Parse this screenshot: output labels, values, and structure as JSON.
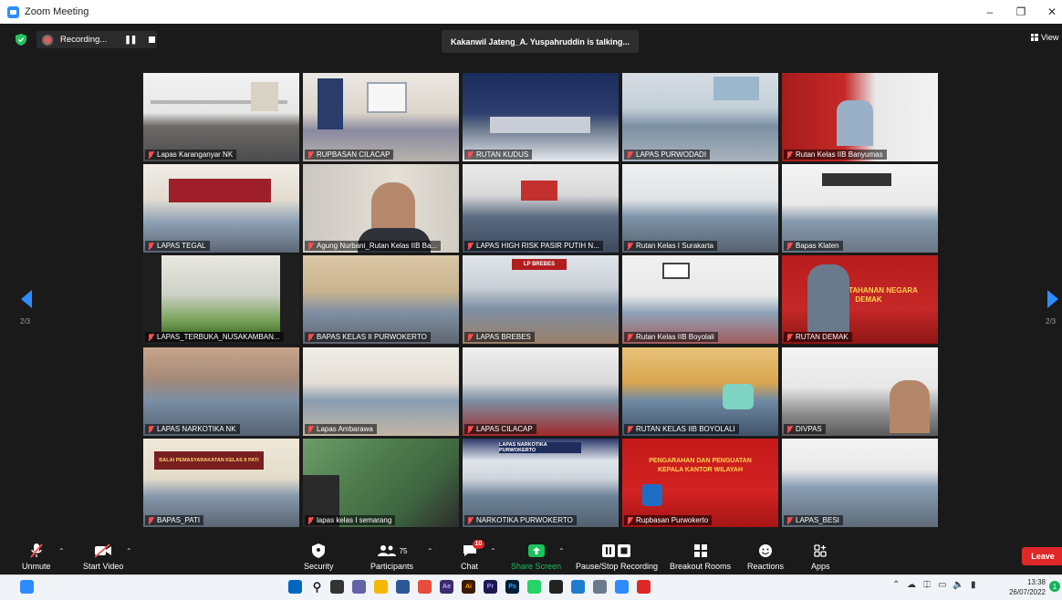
{
  "window": {
    "title": "Zoom Meeting"
  },
  "recording": {
    "label": "Recording..."
  },
  "active_speaker": "Kakanwil Jateng_A. Yuspahruddin is talking...",
  "view_label": "View",
  "pagination": {
    "current": "2/3"
  },
  "participants_tiles": [
    {
      "name": "Lapas Karanganyar NK"
    },
    {
      "name": "RUPBASAN CILACAP"
    },
    {
      "name": "RUTAN KUDUS"
    },
    {
      "name": "LAPAS PURWODADI"
    },
    {
      "name": "Rutan Kelas IIB Banyumas"
    },
    {
      "name": "LAPAS TEGAL"
    },
    {
      "name": "Agung Nurbani_Rutan Kelas IIB Ba..."
    },
    {
      "name": "LAPAS HIGH RISK PASIR PUTIH N..."
    },
    {
      "name": "Rutan Kelas I Surakarta"
    },
    {
      "name": "Bapas Klaten"
    },
    {
      "name": "LAPAS_TERBUKA_NUSAKAMBAN..."
    },
    {
      "name": "BAPAS KELAS II PURWOKERTO"
    },
    {
      "name": "LAPAS BREBES"
    },
    {
      "name": "Rutan Kelas IIB Boyolali"
    },
    {
      "name": "RUTAN DEMAK"
    },
    {
      "name": "LAPAS NARKOTIKA NK"
    },
    {
      "name": "Lapas Ambarawa"
    },
    {
      "name": "LAPAS CILACAP"
    },
    {
      "name": "RUTAN KELAS IIB BOYOLALI"
    },
    {
      "name": "DIVPAS"
    },
    {
      "name": "BAPAS_PATI"
    },
    {
      "name": "lapas kelas I semarang"
    },
    {
      "name": "NARKOTIKA PURWOKERTO"
    },
    {
      "name": "Rupbasan Purwokerto"
    },
    {
      "name": "LAPAS_BESI"
    }
  ],
  "tile_text": {
    "t21_banner": "BALAI PEMASYARAKATAN KELAS II PATI",
    "t23_banner": "LAPAS NARKOTIKA PURWOKERTO",
    "t24_line1": "PENGARAHAN DAN PENGUATAN",
    "t24_line2": "KEPALA KANTOR WILAYAH",
    "t15_wall": "RUMAH TAHANAN NEGARA",
    "t15_wall2": "DEMAK",
    "t13_sign": "LP BREBES"
  },
  "toolbar": {
    "unmute": "Unmute",
    "start_video": "Start Video",
    "security": "Security",
    "participants": "Participants",
    "participants_count": "75",
    "chat": "Chat",
    "chat_badge": "10",
    "share_screen": "Share Screen",
    "pause_recording": "Pause/Stop Recording",
    "breakout_rooms": "Breakout Rooms",
    "reactions": "Reactions",
    "apps": "Apps",
    "leave": "Leave"
  },
  "taskbar": {
    "time": "13:38",
    "date": "26/07/2022",
    "notifications": "1",
    "apps": [
      "Ae",
      "Ai",
      "Pr",
      "Ps"
    ]
  },
  "colors": {
    "accent": "#2d8cff",
    "share_green": "#19c25a",
    "leave_red": "#e02828",
    "muted_red": "#ff4d4d"
  }
}
